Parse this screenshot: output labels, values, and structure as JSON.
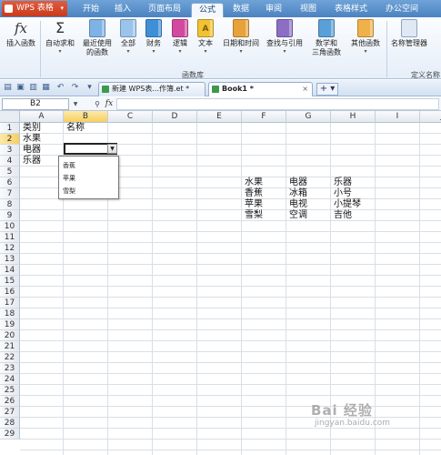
{
  "app": {
    "title": "WPS 表格"
  },
  "menu_tabs": [
    "开始",
    "插入",
    "页面布局",
    "公式",
    "数据",
    "审阅",
    "视图",
    "表格样式",
    "办公空间"
  ],
  "active_menu_tab": "公式",
  "ribbon": {
    "buttons": [
      {
        "label": "插入函数",
        "icon": "fx-icon"
      },
      {
        "label": "自动求和",
        "icon": "sigma-icon"
      },
      {
        "label": "最近使用",
        "label2": "的函数",
        "icon": "recent-functions-icon"
      },
      {
        "label": "全部",
        "icon": "all-functions-icon"
      },
      {
        "label": "财务",
        "icon": "finance-book-icon"
      },
      {
        "label": "逻辑",
        "icon": "logic-book-icon"
      },
      {
        "label": "文本",
        "icon": "text-book-icon"
      },
      {
        "label": "日期和时间",
        "icon": "date-time-book-icon"
      },
      {
        "label": "查找与引用",
        "icon": "lookup-book-icon"
      },
      {
        "label": "数学和",
        "label2": "三角函数",
        "icon": "math-book-icon"
      },
      {
        "label": "其他函数",
        "icon": "other-functions-icon"
      },
      {
        "label": "名称管理器",
        "icon": "name-manager-icon"
      }
    ],
    "group_label": "函数库",
    "group_label2": "定义名称",
    "colors": {
      "finance": "#3f8fd6",
      "logic": "#d24aa0",
      "text": "#f1c232",
      "date": "#e8a23a",
      "lookup": "#8c6fc4",
      "math": "#5aa0d8",
      "other": "#f0b14a"
    }
  },
  "doc_tabs": [
    {
      "label": "新建 WPS表...作簿.et *",
      "active": false
    },
    {
      "label": "Book1 *",
      "active": true
    }
  ],
  "formula_bar": {
    "name_box": "B2",
    "formula": "",
    "fx_label": "fx"
  },
  "grid": {
    "columns": [
      "A",
      "B",
      "C",
      "D",
      "E",
      "F",
      "G",
      "H",
      "I",
      "J"
    ],
    "rows": [
      "1",
      "2",
      "3",
      "4",
      "5",
      "6",
      "7",
      "8",
      "9",
      "10",
      "11",
      "12",
      "13",
      "14",
      "15",
      "16",
      "17",
      "18",
      "19",
      "20",
      "21",
      "22",
      "23",
      "24",
      "25",
      "26",
      "27",
      "28",
      "29"
    ],
    "selected_column": "B",
    "selected_row": "2",
    "cells": [
      {
        "ref": "A1",
        "text": "类别"
      },
      {
        "ref": "B1",
        "text": "名称"
      },
      {
        "ref": "A2",
        "text": "水果"
      },
      {
        "ref": "A3",
        "text": "电器"
      },
      {
        "ref": "A4",
        "text": "乐器"
      },
      {
        "ref": "F6",
        "text": "水果"
      },
      {
        "ref": "G6",
        "text": "电器"
      },
      {
        "ref": "H6",
        "text": "乐器"
      },
      {
        "ref": "F7",
        "text": "香蕉"
      },
      {
        "ref": "G7",
        "text": "冰箱"
      },
      {
        "ref": "H7",
        "text": "小号"
      },
      {
        "ref": "F8",
        "text": "苹果"
      },
      {
        "ref": "G8",
        "text": "电视"
      },
      {
        "ref": "H8",
        "text": "小提琴"
      },
      {
        "ref": "F9",
        "text": "雪梨"
      },
      {
        "ref": "G9",
        "text": "空调"
      },
      {
        "ref": "H9",
        "text": "吉他"
      }
    ]
  },
  "dropdown": {
    "options": [
      "香蕉",
      "苹果",
      "雪梨"
    ]
  },
  "watermark": {
    "logo": "Bai 经验",
    "url": "jingyan.baidu.com"
  }
}
